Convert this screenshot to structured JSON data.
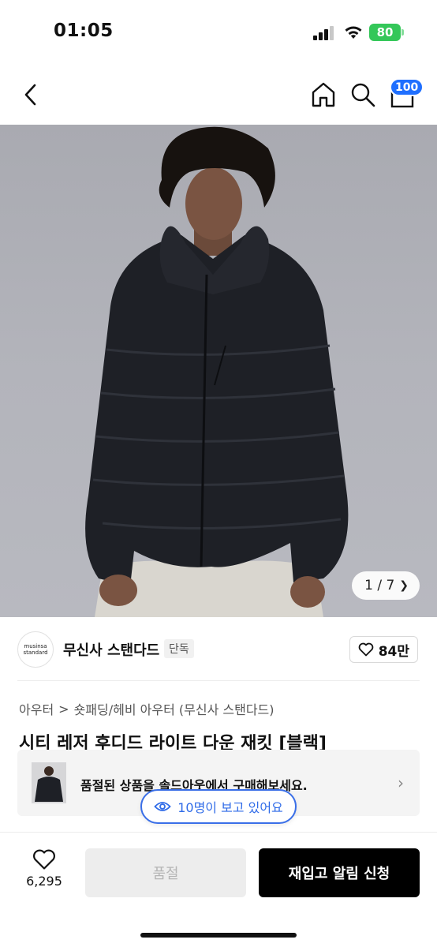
{
  "status_bar": {
    "time": "01:05",
    "battery": "80"
  },
  "nav": {
    "cart_badge": "100"
  },
  "gallery": {
    "counter": "1 / 7"
  },
  "brand": {
    "logo_line1": "musinsa",
    "logo_line2": "standard",
    "name": "무신사 스탠다드",
    "tag": "단독",
    "likes": "84만"
  },
  "breadcrumb": {
    "level1": "아우터",
    "separator": ">",
    "level2": "숏패딩/헤비 아우터 (무신사 스탠다드)"
  },
  "product": {
    "title": "시티 레저 후디드 라이트 다운 재킷 [블랙]"
  },
  "soldout_banner": {
    "text": "품절된 상품을 솔드아웃에서 구매해보세요."
  },
  "viewers": {
    "text": "10명이 보고 있어요"
  },
  "bottom_bar": {
    "wishlist_count": "6,295",
    "soldout_label": "품절",
    "restock_label": "재입고 알림 신청"
  },
  "colors": {
    "accent": "#1f6fff",
    "battery": "#34c759",
    "primary_button": "#000000",
    "disabled_button": "#ededed"
  },
  "icons": {
    "back": "chevron-left-icon",
    "home": "home-icon",
    "search": "search-icon",
    "cart": "shopping-bag-icon",
    "heart": "heart-icon",
    "eye": "eye-icon"
  }
}
